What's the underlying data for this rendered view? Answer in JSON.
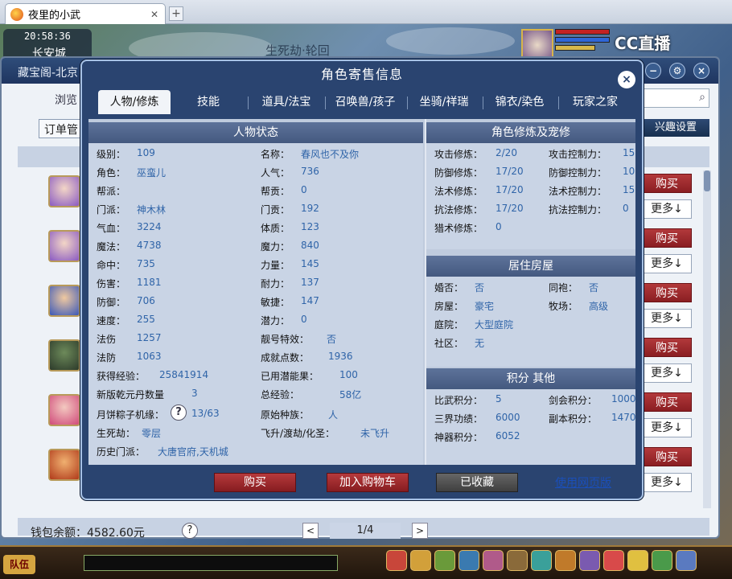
{
  "browser": {
    "tab_title": "夜里的小武",
    "tab_close": "✕",
    "new_tab": "+"
  },
  "game": {
    "time": "20:58:36",
    "city": "长安城",
    "map_hint": "生死劫·轮回",
    "stream_logo": "CC直播",
    "team_label": "队伍"
  },
  "back_panel": {
    "title": "藏宝阁-北京",
    "browse_label": "浏览",
    "order_label": "订单管",
    "interest_label": "兴趣设置",
    "buy_label": "购买",
    "more_label": "更多↓",
    "wallet_label": "钱包余额：4582.60元",
    "help": "?",
    "page_indicator": "1/4",
    "prev": "<",
    "next": ">"
  },
  "dialog": {
    "title": "角色寄售信息",
    "close": "×",
    "tabs": [
      "人物/修炼",
      "技能",
      "道具/法宝",
      "召唤兽/孩子",
      "坐骑/祥瑞",
      "锦衣/染色",
      "玩家之家"
    ],
    "active_tab": "人物/修炼",
    "status_header": "人物状态",
    "cultivation_header": "角色修炼及宠修",
    "house_header": "居住房屋",
    "score_header": "积分 其他",
    "status_left": [
      {
        "label": "级别：",
        "value": "109"
      },
      {
        "label": "角色：",
        "value": "巫蛮儿"
      },
      {
        "label": "帮派：",
        "value": ""
      },
      {
        "label": "门派：",
        "value": "神木林"
      },
      {
        "label": "气血：",
        "value": "3224"
      },
      {
        "label": "魔法：",
        "value": "4738"
      },
      {
        "label": "命中：",
        "value": "735"
      },
      {
        "label": "伤害：",
        "value": "1181"
      },
      {
        "label": "防御：",
        "value": "706"
      },
      {
        "label": "速度：",
        "value": "255"
      },
      {
        "label": "法伤",
        "value": "1257"
      },
      {
        "label": "法防",
        "value": "1063"
      },
      {
        "label": "获得经验：",
        "value": "25841914"
      },
      {
        "label": "新版乾元丹数量",
        "value": "3"
      },
      {
        "label": "月饼粽子机缘：",
        "value": "13/63"
      },
      {
        "label": "生死劫：",
        "value": "零层"
      },
      {
        "label": "历史门派：",
        "value": "大唐官府,天机城"
      }
    ],
    "status_right": [
      {
        "label": "名称：",
        "value": "春风也不及你"
      },
      {
        "label": "人气：",
        "value": "736"
      },
      {
        "label": "帮贡：",
        "value": "0"
      },
      {
        "label": "门贡：",
        "value": "192"
      },
      {
        "label": "体质：",
        "value": "123"
      },
      {
        "label": "魔力：",
        "value": "840"
      },
      {
        "label": "力量：",
        "value": "145"
      },
      {
        "label": "耐力：",
        "value": "137"
      },
      {
        "label": "敏捷：",
        "value": "147"
      },
      {
        "label": "潜力：",
        "value": "0"
      },
      {
        "label": "靓号特效：",
        "value": "否"
      },
      {
        "label": "成就点数：",
        "value": "1936"
      },
      {
        "label": "已用潜能果：",
        "value": "100"
      },
      {
        "label": "总经验：",
        "value": "58亿"
      },
      {
        "label": "原始种族：",
        "value": "人"
      },
      {
        "label": "飞升/渡劫/化圣：",
        "value": "未飞升"
      }
    ],
    "cultivation": [
      {
        "l1": "攻击修炼：",
        "v1": "2/20",
        "l2": "攻击控制力：",
        "v2": "15"
      },
      {
        "l1": "防御修炼：",
        "v1": "17/20",
        "l2": "防御控制力：",
        "v2": "10"
      },
      {
        "l1": "法术修炼：",
        "v1": "17/20",
        "l2": "法术控制力：",
        "v2": "15"
      },
      {
        "l1": "抗法修炼：",
        "v1": "17/20",
        "l2": "抗法控制力：",
        "v2": "0"
      },
      {
        "l1": "猎术修炼：",
        "v1": "0",
        "l2": "",
        "v2": ""
      }
    ],
    "house": [
      {
        "l1": "婚否：",
        "v1": "否",
        "l2": "同袍：",
        "v2": "否"
      },
      {
        "l1": "房屋：",
        "v1": "豪宅",
        "l2": "牧场：",
        "v2": "高级"
      },
      {
        "l1": "庭院：",
        "v1": "大型庭院",
        "l2": "",
        "v2": ""
      },
      {
        "l1": "社区：",
        "v1": "无",
        "l2": "",
        "v2": ""
      }
    ],
    "scores": [
      {
        "l1": "比武积分：",
        "v1": "5",
        "l2": "剑会积分：",
        "v2": "1000"
      },
      {
        "l1": "三界功绩：",
        "v1": "6000",
        "l2": "副本积分：",
        "v2": "1470"
      },
      {
        "l1": "神器积分：",
        "v1": "6052",
        "l2": "",
        "v2": ""
      }
    ],
    "buttons": {
      "buy": "购买",
      "add_cart": "加入购物车",
      "collected": "已收藏",
      "web_version": "使用网页版"
    },
    "help": "?"
  }
}
